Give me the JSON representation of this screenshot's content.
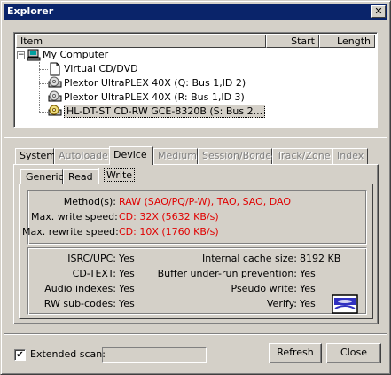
{
  "window": {
    "title": "Explorer",
    "close_glyph": "✕"
  },
  "listview": {
    "columns": [
      "Item",
      "Start",
      "Length"
    ],
    "tree": {
      "root": {
        "label": "My Computer",
        "icon": "computer-icon",
        "expander": "−"
      },
      "children": [
        {
          "label": "Virtual CD/DVD",
          "icon": "document-icon"
        },
        {
          "label": "Plextor UltraPLEX 40X (Q: Bus 1,ID 2)",
          "icon": "cd-drive-icon"
        },
        {
          "label": "Plextor UltraPLEX 40X (R: Bus 1,ID 3)",
          "icon": "cd-drive-icon"
        },
        {
          "label": "HL-DT-ST CD-RW GCE-8320B (S: Bus 2...",
          "icon": "cd-writer-icon",
          "selected": true
        }
      ]
    }
  },
  "tabs": [
    {
      "label": "System",
      "state": "enabled"
    },
    {
      "label": "Autoloader",
      "state": "disabled"
    },
    {
      "label": "Device",
      "state": "active"
    },
    {
      "label": "Medium",
      "state": "disabled"
    },
    {
      "label": "Session/Border",
      "state": "disabled"
    },
    {
      "label": "Track/Zone",
      "state": "disabled"
    },
    {
      "label": "Index",
      "state": "disabled"
    }
  ],
  "subtabs": [
    {
      "label": "Generic",
      "state": "enabled"
    },
    {
      "label": "Read",
      "state": "enabled"
    },
    {
      "label": "Write",
      "state": "active"
    }
  ],
  "write_caps": {
    "methods_label": "Method(s):",
    "methods_value": "RAW (SAO/PQ/P-W), TAO, SAO, DAO",
    "write_speed_label": "Max. write speed:",
    "write_speed_value": "CD: 32X (5632 KB/s)",
    "rewrite_speed_label": "Max. rewrite speed:",
    "rewrite_speed_value": "CD: 10X (1760 KB/s)"
  },
  "features": {
    "isrc_label": "ISRC/UPC:",
    "isrc_value": "Yes",
    "cdtext_label": "CD-TEXT:",
    "cdtext_value": "Yes",
    "audio_idx_label": "Audio indexes:",
    "audio_idx_value": "Yes",
    "rw_sub_label": "RW sub-codes:",
    "rw_sub_value": "Yes",
    "cache_label": "Internal cache size:",
    "cache_value": "8192 KB",
    "buffer_label": "Buffer under-run prevention:",
    "buffer_value": "Yes",
    "pseudo_label": "Pseudo write:",
    "pseudo_value": "Yes",
    "verify_label": "Verify:",
    "verify_value": "Yes",
    "logo_icon": "cd-rw-logo-icon"
  },
  "footer": {
    "extended_scan_label": "Extended scan:",
    "extended_scan_checked": true,
    "check_glyph": "✔",
    "extended_scan_progress": 0,
    "refresh_label": "Refresh",
    "close_label": "Close"
  },
  "colors": {
    "title_bar": "#0a246a",
    "face": "#d4d0c8",
    "value_red": "#e00000"
  }
}
